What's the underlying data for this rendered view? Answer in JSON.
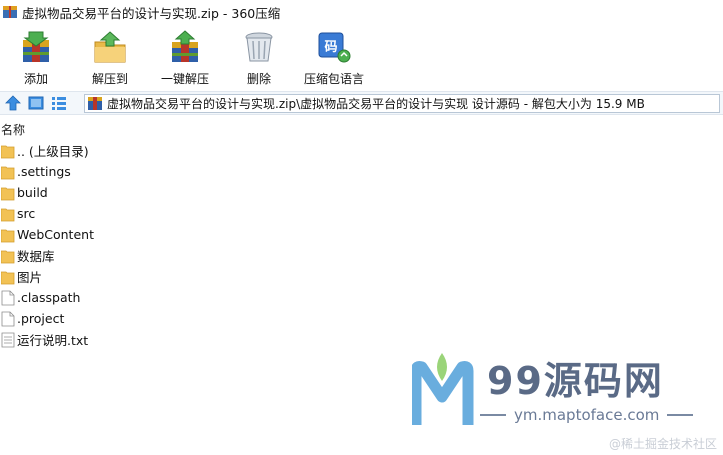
{
  "window": {
    "title": "虚拟物品交易平台的设计与实现.zip - 360压缩"
  },
  "toolbar": {
    "buttons": [
      {
        "label": "添加",
        "icon": "add-archive-icon"
      },
      {
        "label": "解压到",
        "icon": "extract-folder-icon"
      },
      {
        "label": "一键解压",
        "icon": "one-click-extract-icon"
      },
      {
        "label": "删除",
        "icon": "trash-can-icon"
      },
      {
        "label": "压缩包语言",
        "icon": "archive-language-icon"
      }
    ]
  },
  "addressbar": {
    "path": "虚拟物品交易平台的设计与实现.zip\\虚拟物品交易平台的设计与实现 设计源码 - 解包大小为 15.9 MB"
  },
  "columns": {
    "name_header": "名称"
  },
  "files": [
    {
      "name": ".. (上级目录)",
      "type": "folder"
    },
    {
      "name": ".settings",
      "type": "folder"
    },
    {
      "name": "build",
      "type": "folder"
    },
    {
      "name": "src",
      "type": "folder"
    },
    {
      "name": "WebContent",
      "type": "folder"
    },
    {
      "name": "数据库",
      "type": "folder"
    },
    {
      "name": "图片",
      "type": "folder"
    },
    {
      "name": ".classpath",
      "type": "file"
    },
    {
      "name": ".project",
      "type": "file"
    },
    {
      "name": "运行说明.txt",
      "type": "text"
    }
  ],
  "watermark": {
    "brand": "99源码网",
    "url": "ym.maptoface.com"
  },
  "credit": "@稀土掘金技术社区"
}
